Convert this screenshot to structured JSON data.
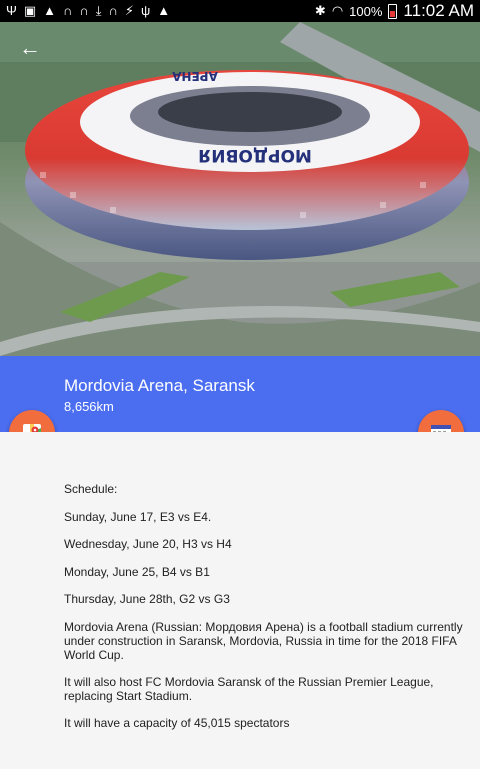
{
  "status_bar": {
    "battery": "100%",
    "time": "11:02 AM",
    "left_icons": [
      "usb-icon",
      "image-icon",
      "warning-icon",
      "headset-icon",
      "headset-icon",
      "download-icon",
      "headset-icon",
      "signal-icon",
      "wifi-bars-icon",
      "warning-icon"
    ]
  },
  "header": {
    "back_icon": "arrow-back-icon",
    "title": "Mordovia Arena, Saransk",
    "distance": "8,656km"
  },
  "fabs": {
    "left_icon": "map-icon",
    "right_icon": "calendar-icon"
  },
  "content": {
    "schedule_label": "Schedule:",
    "matches": [
      "Sunday, June 17, E3 vs E4.",
      "Wednesday, June 20, H3 vs H4",
      "Monday, June 25, B4 vs B1",
      "Thursday, June 28th, G2 vs G3"
    ],
    "description": "Mordovia Arena (Russian: Мордовия Арена) is a football stadium currently under construction in Saransk, Mordovia, Russia in time for the 2018 FIFA World Cup.",
    "host_note": "It will also host FC Mordovia Saransk of the Russian Premier League, replacing Start Stadium.",
    "capacity": "It will have a capacity of 45,015 spectators"
  },
  "colors": {
    "accent_blue": "#4b6ef0",
    "fab_orange": "#f26d3d",
    "status_bar": "#000000"
  }
}
